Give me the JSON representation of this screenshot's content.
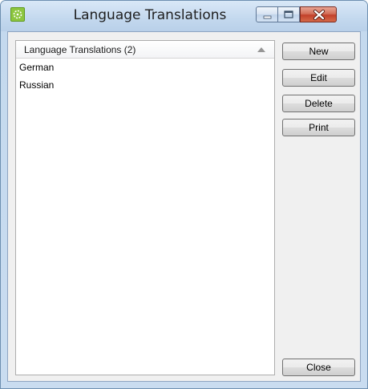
{
  "window": {
    "title": "Language Translations"
  },
  "list": {
    "header": "Language Translations (2)",
    "items": [
      "German",
      "Russian"
    ]
  },
  "buttons": {
    "new": "New",
    "edit": "Edit",
    "delete": "Delete",
    "print": "Print",
    "close": "Close"
  },
  "icons": {
    "app": "app-icon",
    "minimize": "minimize-icon",
    "maximize": "maximize-icon",
    "close": "close-icon",
    "sort": "sort-ascending-icon"
  },
  "colors": {
    "close_button": "#c2402a",
    "app_icon": "#8dc63f"
  }
}
